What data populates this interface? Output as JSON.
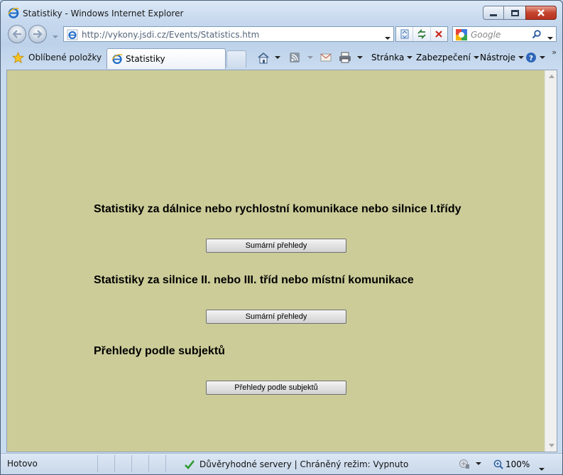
{
  "window": {
    "title": "Statistiky - Windows Internet Explorer"
  },
  "address_bar": {
    "url": "http://vykony.jsdi.cz/Events/Statistics.htm",
    "search_placeholder": "Google"
  },
  "command_bar": {
    "favorites_label": "Oblíbené položky",
    "tab_label": "Statistiky",
    "page_menu": "Stránka",
    "security_menu": "Zabezpečení",
    "tools_menu": "Nástroje"
  },
  "content": {
    "sections": [
      {
        "heading": "Statistiky za dálnice nebo rychlostní komunikace nebo silnice I.třídy",
        "button": "Sumární přehledy"
      },
      {
        "heading": "Statistiky za silnice II. nebo III. tříd nebo místní komunikace",
        "button": "Sumární přehledy"
      },
      {
        "heading": "Přehledy podle subjektů",
        "button": "Přehledy podle subjektů"
      }
    ],
    "background": "#cccc99"
  },
  "status_bar": {
    "status": "Hotovo",
    "zone": "Důvěryhodné servery | Chráněný režim: Vypnuto",
    "zoom": "100%"
  },
  "colors": {
    "page_background": "#cccc99",
    "chrome": "#c6d8ee",
    "close_button": "#c4442e",
    "trusted_check": "#2e9a2e"
  },
  "icons": [
    "ie-icon",
    "back-arrow-icon",
    "forward-arrow-icon",
    "compat-view-icon",
    "refresh-icon",
    "stop-icon",
    "google-icon",
    "search-icon",
    "star-icon",
    "home-icon",
    "rss-icon",
    "mail-icon",
    "print-icon",
    "help-icon",
    "checkmark-icon",
    "security-icon",
    "zoom-icon"
  ]
}
